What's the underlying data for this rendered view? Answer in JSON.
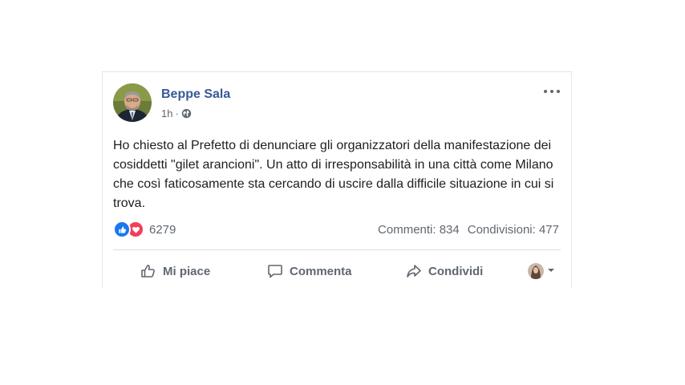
{
  "post": {
    "author": "Beppe Sala",
    "time": "1h",
    "separator": "·",
    "privacy_icon": "globe-icon",
    "text": "Ho chiesto al Prefetto di denunciare gli organizzatori della manifestazione dei cosiddetti \"gilet arancioni\". Un atto di irresponsabilità in una città come Milano che così faticosamente sta cercando di uscire dalla difficile situazione in cui si trova.",
    "reactions_count": "6279",
    "comments": "Commenti: 834",
    "shares": "Condivisioni: 477"
  },
  "actions": {
    "like": "Mi piace",
    "comment": "Commenta",
    "share": "Condividi"
  },
  "colors": {
    "author_link": "#385898",
    "like_blue": "#1877f2",
    "love_red": "#f33e58",
    "secondary_text": "#606770"
  }
}
